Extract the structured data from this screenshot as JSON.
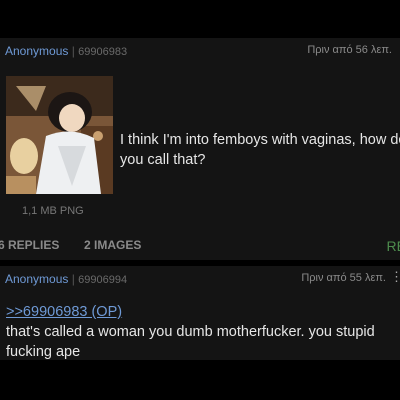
{
  "post1": {
    "author": "Anonymous",
    "number": "69906983",
    "time": "Πριν από 56 λεπ.",
    "thumbnail_icon": "anime-character-thumbnail",
    "file_size": "1,1 MB PNG",
    "comment": "I think I'm into femboys with vaginas, how do you call that?",
    "replies_label": "6 REPLIES",
    "images_label": "2 IMAGES",
    "reply_button": "RE"
  },
  "post2": {
    "author": "Anonymous",
    "number": "69906994",
    "time": "Πριν από 55 λεπ.",
    "menu_icon": "more-dots-icon",
    "quote_link": ">>69906983 (OP)",
    "comment": "that's called a woman you dumb motherfucker. you stupid fucking ape"
  },
  "colors": {
    "background": "#000000",
    "post_background": "#141414",
    "name": "#6f9ad6",
    "text": "#e6e6e6",
    "muted": "#8a8a8a",
    "reply_green": "#4d8c4d"
  }
}
